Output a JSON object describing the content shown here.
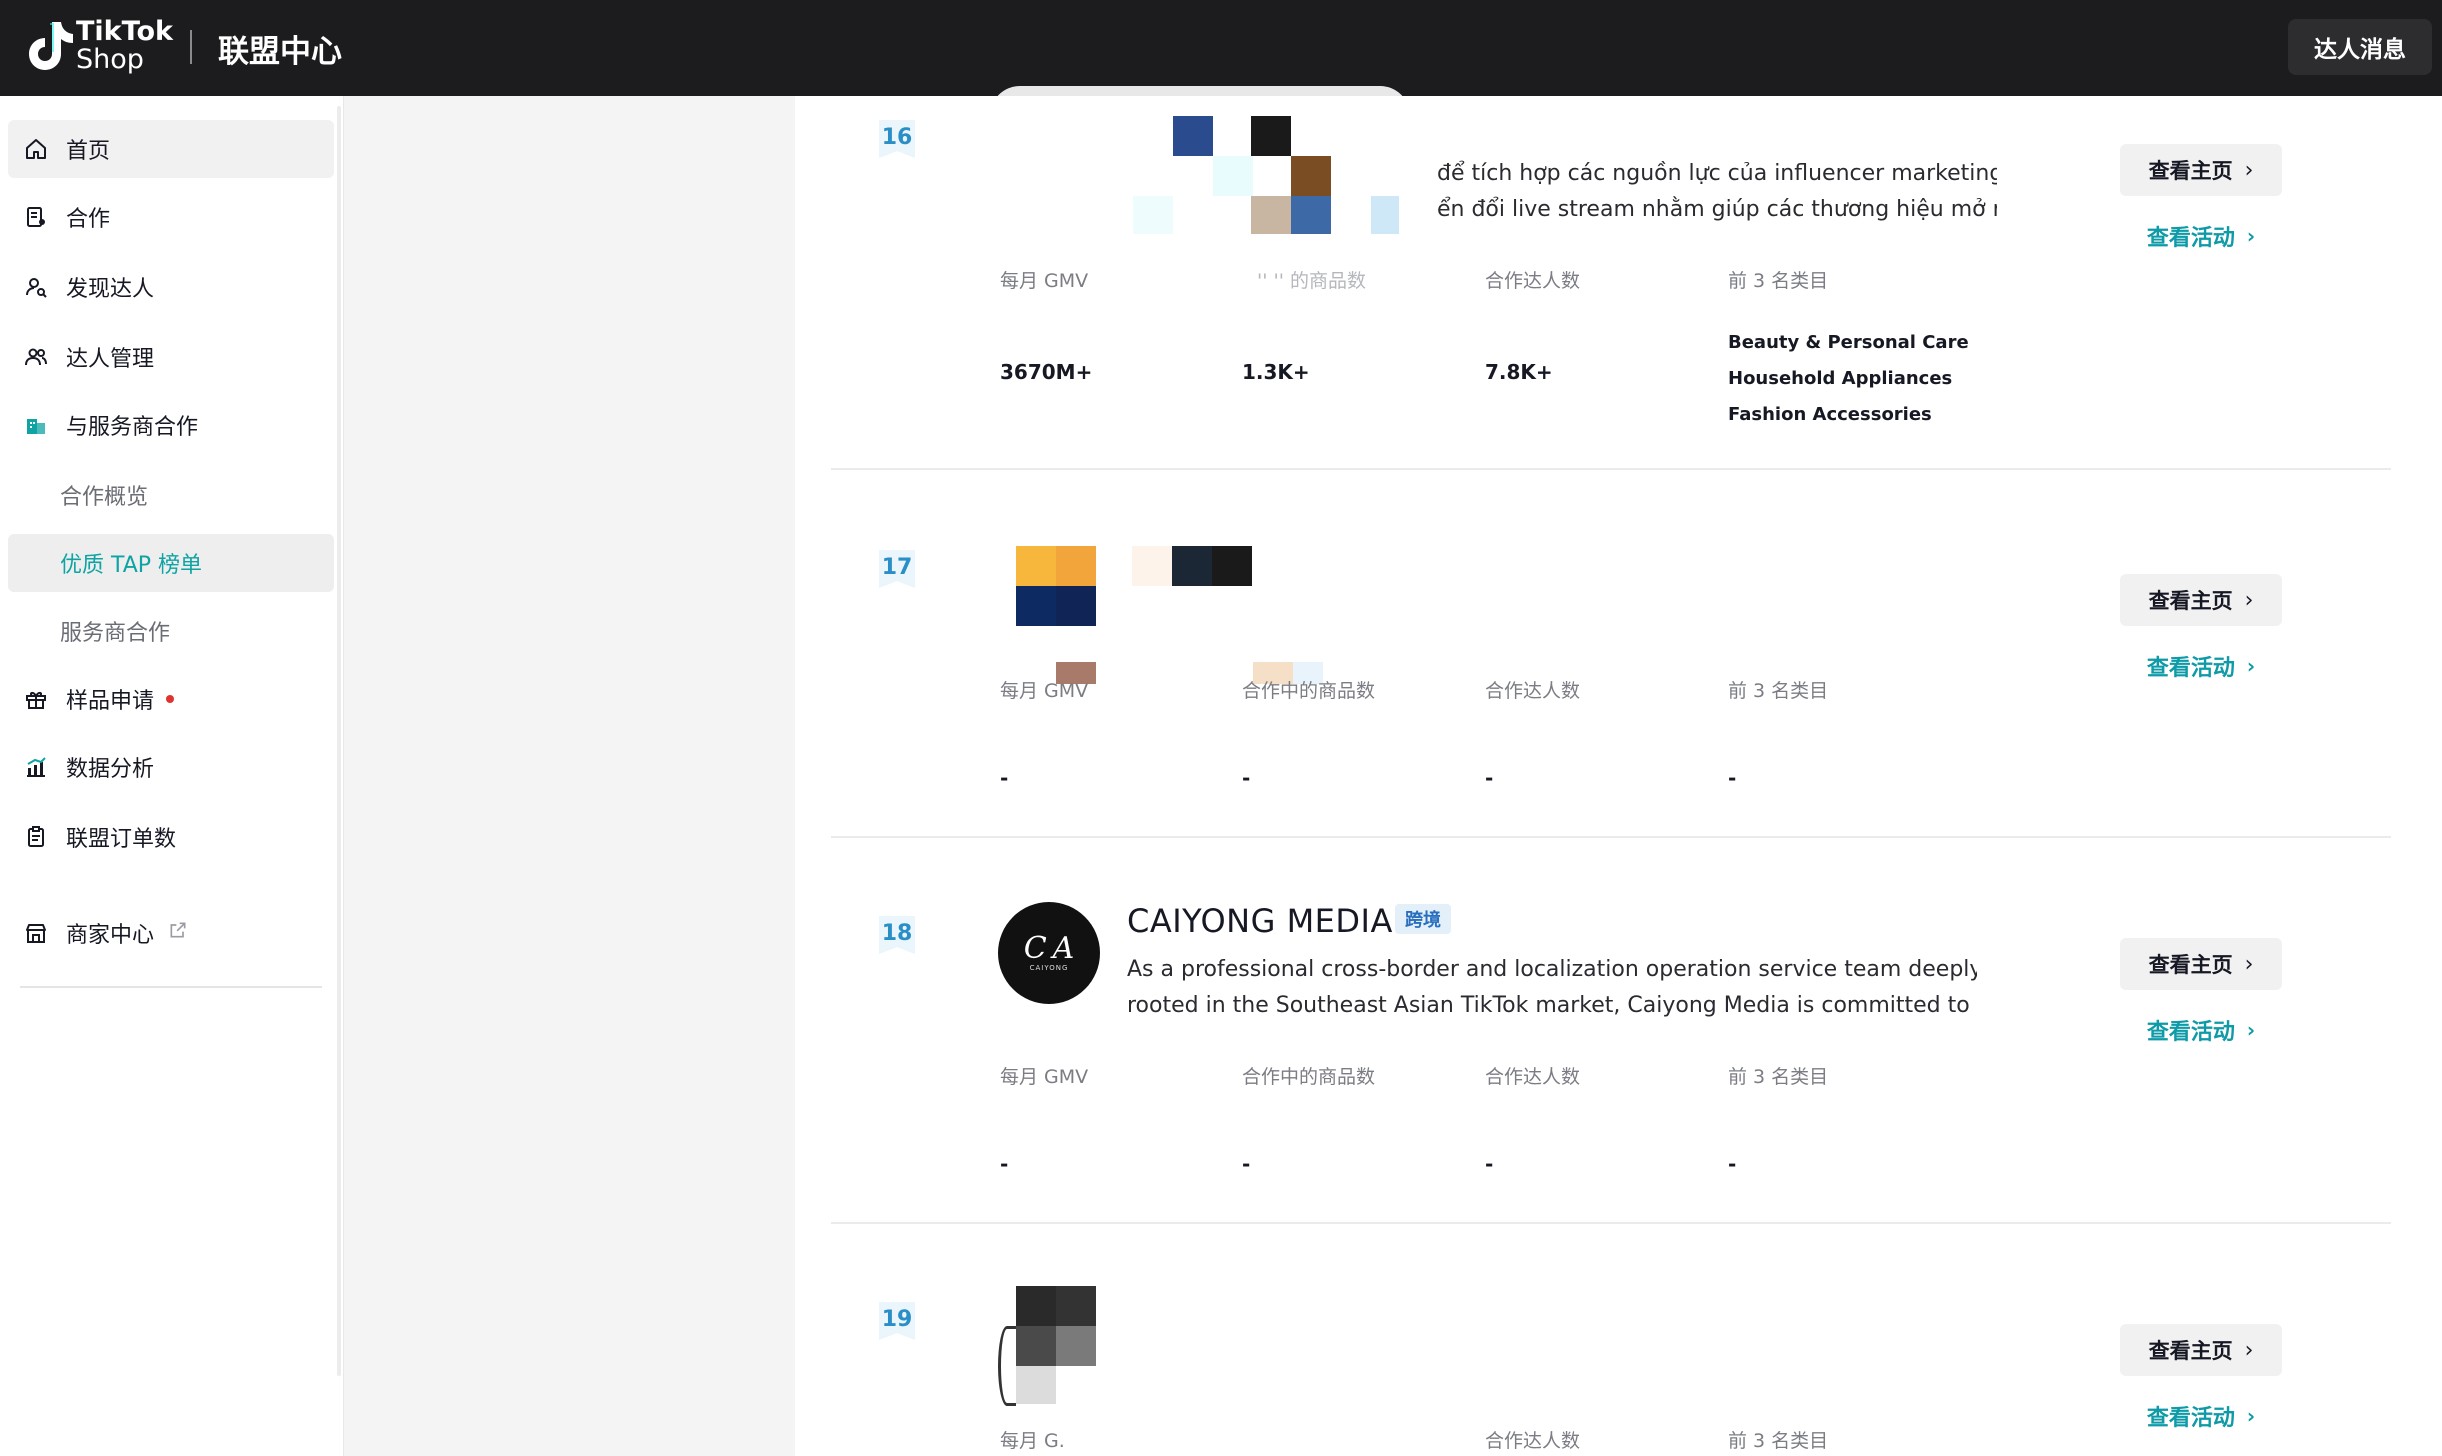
{
  "header": {
    "brand_line1": "TikTok",
    "brand_line2": "Shop",
    "title": "联盟中心",
    "messages_button": "达人消息"
  },
  "sidebar": {
    "items": [
      {
        "label": "首页",
        "icon": "home-icon"
      },
      {
        "label": "合作",
        "icon": "document-icon"
      },
      {
        "label": "发现达人",
        "icon": "user-search-icon"
      },
      {
        "label": "达人管理",
        "icon": "users-icon"
      },
      {
        "label": "与服务商合作",
        "icon": "building-icon"
      },
      {
        "label": "合作概览"
      },
      {
        "label": "优质 TAP 榜单"
      },
      {
        "label": "服务商合作"
      },
      {
        "label": "样品申请",
        "icon": "gift-icon"
      },
      {
        "label": "数据分析",
        "icon": "bar-chart-icon"
      },
      {
        "label": "联盟订单数",
        "icon": "clipboard-icon"
      },
      {
        "label": "商家中心",
        "icon": "store-icon"
      }
    ],
    "accent_color": "#0fa3a3"
  },
  "list": {
    "stat_labels": {
      "gmv": "每月 GMV",
      "products": "合作中的商品数",
      "creators": "合作达人数",
      "categories": "前 3 名类目"
    },
    "view_home": "查看主页",
    "view_activity": "查看活动",
    "rows": [
      {
        "rank": "16",
        "desc_line1": "để tích hợp các nguồn lực của influencer marketing,",
        "desc_line2": "ển đổi live stream nhằm giúp các thương hiệu mở r...",
        "gmv_label": "每月 GMV",
        "products_label": "'' '' 的商品数",
        "gmv": "3670M+",
        "products": "1.3K+",
        "creators": "7.8K+",
        "categories": [
          "Beauty & Personal Care",
          "Household Appliances",
          "Fashion Accessories"
        ]
      },
      {
        "rank": "17",
        "gmv_label": "每月 GMV",
        "products_label": "合作中的商品数",
        "gmv": "-",
        "products": "-",
        "creators": "-",
        "categories": "-"
      },
      {
        "rank": "18",
        "name": "CAIYONG MEDIA",
        "tag": "跨境",
        "avatar_mark": "C A",
        "avatar_word": "CAIYONG",
        "desc_line1": "As a professional cross-border and localization operation service team deeply",
        "desc_line2": "rooted in the Southeast Asian TikTok market, Caiyong Media is committed to pro...",
        "gmv_label": "每月 GMV",
        "products_label": "合作中的商品数",
        "gmv": "-",
        "products": "-",
        "creators": "-",
        "categories": "-"
      },
      {
        "rank": "19",
        "gmv_label": "每月 G.",
        "creators_label": "合作达人数",
        "categories_label": "前 3 名类目"
      }
    ]
  }
}
